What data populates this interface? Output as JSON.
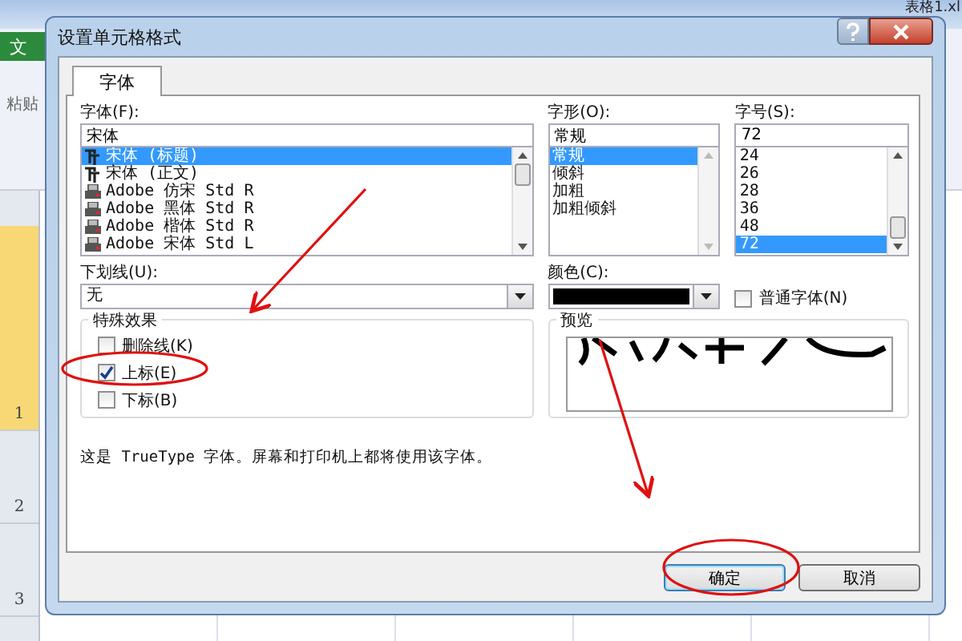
{
  "excel": {
    "file_tab": "文",
    "paste": "粘贴",
    "title": "表格1.xl",
    "rows": [
      "1",
      "2",
      "3"
    ]
  },
  "dialog": {
    "title": "设置单元格格式",
    "tabs": [
      {
        "label": "字体",
        "selected": true
      }
    ],
    "font": {
      "label": "字体(F):",
      "value": "宋体",
      "items": [
        {
          "label": "宋体 (标题)",
          "kind": "truetype",
          "selected": true
        },
        {
          "label": "宋体 (正文)",
          "kind": "truetype",
          "selected": false
        },
        {
          "label": "Adobe 仿宋 Std R",
          "kind": "opentype",
          "selected": false
        },
        {
          "label": "Adobe 黑体 Std R",
          "kind": "opentype",
          "selected": false
        },
        {
          "label": "Adobe 楷体 Std R",
          "kind": "opentype",
          "selected": false
        },
        {
          "label": "Adobe 宋体 Std L",
          "kind": "opentype",
          "selected": false
        }
      ]
    },
    "style": {
      "label": "字形(O):",
      "value": "常规",
      "items": [
        {
          "label": "常规",
          "selected": true
        },
        {
          "label": "倾斜",
          "selected": false
        },
        {
          "label": "加粗",
          "selected": false
        },
        {
          "label": "加粗倾斜",
          "selected": false
        }
      ]
    },
    "size": {
      "label": "字号(S):",
      "value": "72",
      "items": [
        {
          "label": "24",
          "selected": false
        },
        {
          "label": "26",
          "selected": false
        },
        {
          "label": "28",
          "selected": false
        },
        {
          "label": "36",
          "selected": false
        },
        {
          "label": "48",
          "selected": false
        },
        {
          "label": "72",
          "selected": true
        }
      ]
    },
    "underline": {
      "label": "下划线(U):",
      "value": "无"
    },
    "color": {
      "label": "颜色(C):",
      "color": "#000000"
    },
    "normal_font": {
      "label": "普通字体(N)",
      "checked": false
    },
    "effects": {
      "legend": "特殊效果",
      "items": [
        {
          "label": "删除线(K)",
          "checked": false
        },
        {
          "label": "上标(E)",
          "checked": true
        },
        {
          "label": "下标(B)",
          "checked": false
        }
      ]
    },
    "preview": {
      "legend": "预览"
    },
    "note": "这是 TrueType 字体。屏幕和打印机上都将使用该字体。",
    "buttons": [
      {
        "label": "确定",
        "default": true
      },
      {
        "label": "取消",
        "default": false
      }
    ]
  }
}
